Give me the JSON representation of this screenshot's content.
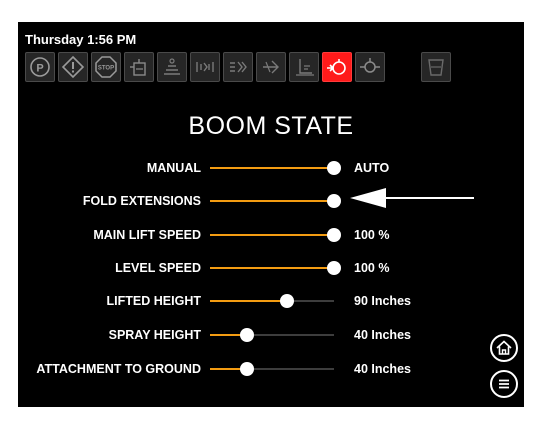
{
  "status": {
    "datetime": "Thursday 1:56 PM"
  },
  "toolbar": {
    "icons": [
      {
        "name": "parking-brake-icon",
        "glyph": "(P)",
        "active": false
      },
      {
        "name": "warning-icon",
        "glyph": "!",
        "active": false
      },
      {
        "name": "stop-icon",
        "glyph": "STOP",
        "active": false
      },
      {
        "name": "sprayer-tank-icon",
        "active": false
      },
      {
        "name": "field-work-icon",
        "active": false
      },
      {
        "name": "boom-section-icon",
        "active": false
      },
      {
        "name": "boom-sections-multi-icon",
        "active": false
      },
      {
        "name": "boom-fold-icon",
        "active": false
      },
      {
        "name": "boom-height-icon",
        "active": false
      },
      {
        "name": "boom-state-icon",
        "active": true
      },
      {
        "name": "boom-lift-icon",
        "active": false
      },
      {
        "name": "rinse-tank-icon",
        "active": false
      }
    ]
  },
  "page": {
    "title": "BOOM STATE"
  },
  "settings": [
    {
      "label": "MANUAL",
      "level": 1.0,
      "value": "AUTO"
    },
    {
      "label": "FOLD EXTENSIONS",
      "level": 1.0,
      "value": ""
    },
    {
      "label": "MAIN LIFT SPEED",
      "level": 1.0,
      "value": "100 %"
    },
    {
      "label": "LEVEL SPEED",
      "level": 1.0,
      "value": "100 %"
    },
    {
      "label": "LIFTED HEIGHT",
      "level": 0.62,
      "value": "90 Inches"
    },
    {
      "label": "SPRAY HEIGHT",
      "level": 0.3,
      "value": "40 Inches"
    },
    {
      "label": "ATTACHMENT TO GROUND",
      "level": 0.3,
      "value": "40 Inches"
    }
  ],
  "colors": {
    "accent": "#f39c12",
    "active_tile": "#ff1a1a",
    "screen_bg": "#000000"
  },
  "nav": {
    "home_icon": "home-icon",
    "menu_icon": "menu-icon"
  }
}
